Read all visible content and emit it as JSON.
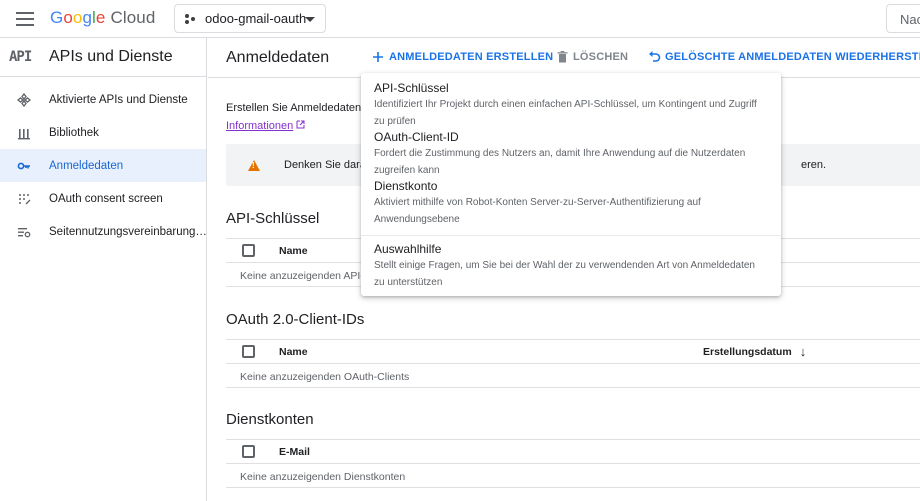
{
  "topbar": {
    "logo_google": [
      "G",
      "o",
      "o",
      "g",
      "l",
      "e"
    ],
    "logo_cloud": "Cloud",
    "project_name": "odoo-gmail-oauth",
    "search_stub": "Nac"
  },
  "sidebar": {
    "badge": "API",
    "title": "APIs und Dienste",
    "items": [
      {
        "label": "Aktivierte APIs und Dienste",
        "icon": "apis-services-icon"
      },
      {
        "label": "Bibliothek",
        "icon": "library-icon"
      },
      {
        "label": "Anmeldedaten",
        "icon": "key-icon",
        "active": true
      },
      {
        "label": "OAuth consent screen",
        "icon": "consent-screen-icon"
      },
      {
        "label": "Seitennutzungsvereinbarung…",
        "icon": "page-usage-agreement-icon"
      }
    ]
  },
  "main": {
    "title": "Anmeldedaten",
    "actions": {
      "create": "ANMELDEDATEN ERSTELLEN",
      "delete": "LÖSCHEN",
      "restore": "GELÖSCHTE ANMELDEDATEN WIEDERHERSTELLEN"
    },
    "intro_text": "Erstellen Sie Anmeldedaten,",
    "intro_link": "Informationen",
    "info_text": "Denken Sie daran",
    "info_text_end": "eren.",
    "sections": {
      "api_keys": {
        "title": "API-Schlüssel",
        "col_name": "Name",
        "empty": "Keine anzuzeigenden API-Schlüssel"
      },
      "oauth": {
        "title": "OAuth 2.0-Client-IDs",
        "col_name": "Name",
        "col_date": "Erstellungsdatum",
        "empty": "Keine anzuzeigenden OAuth-Clients"
      },
      "service": {
        "title": "Dienstkonten",
        "col_email": "E-Mail",
        "empty": "Keine anzuzeigenden Dienstkonten"
      }
    }
  },
  "menu": {
    "items": [
      {
        "title": "API-Schlüssel",
        "desc": "Identifiziert Ihr Projekt durch einen einfachen API-Schlüssel, um Kontingent und Zugriff zu prüfen"
      },
      {
        "title": "OAuth-Client-ID",
        "desc": "Fordert die Zustimmung des Nutzers an, damit Ihre Anwendung auf die Nutzerdaten zugreifen kann"
      },
      {
        "title": "Dienstkonto",
        "desc": "Aktiviert mithilfe von Robot-Konten Server-zu-Server-Authentifizierung auf Anwendungsebene"
      }
    ],
    "helper": {
      "title": "Auswahlhilfe",
      "desc": "Stellt einige Fragen, um Sie bei der Wahl der zu verwendenden Art von Anmeldedaten zu unterstützen"
    }
  },
  "colors": {
    "accent": "#1a73e8",
    "active_nav_bg": "#e8f0fe",
    "warning": "#e37400",
    "link_visited": "#8430ce"
  }
}
